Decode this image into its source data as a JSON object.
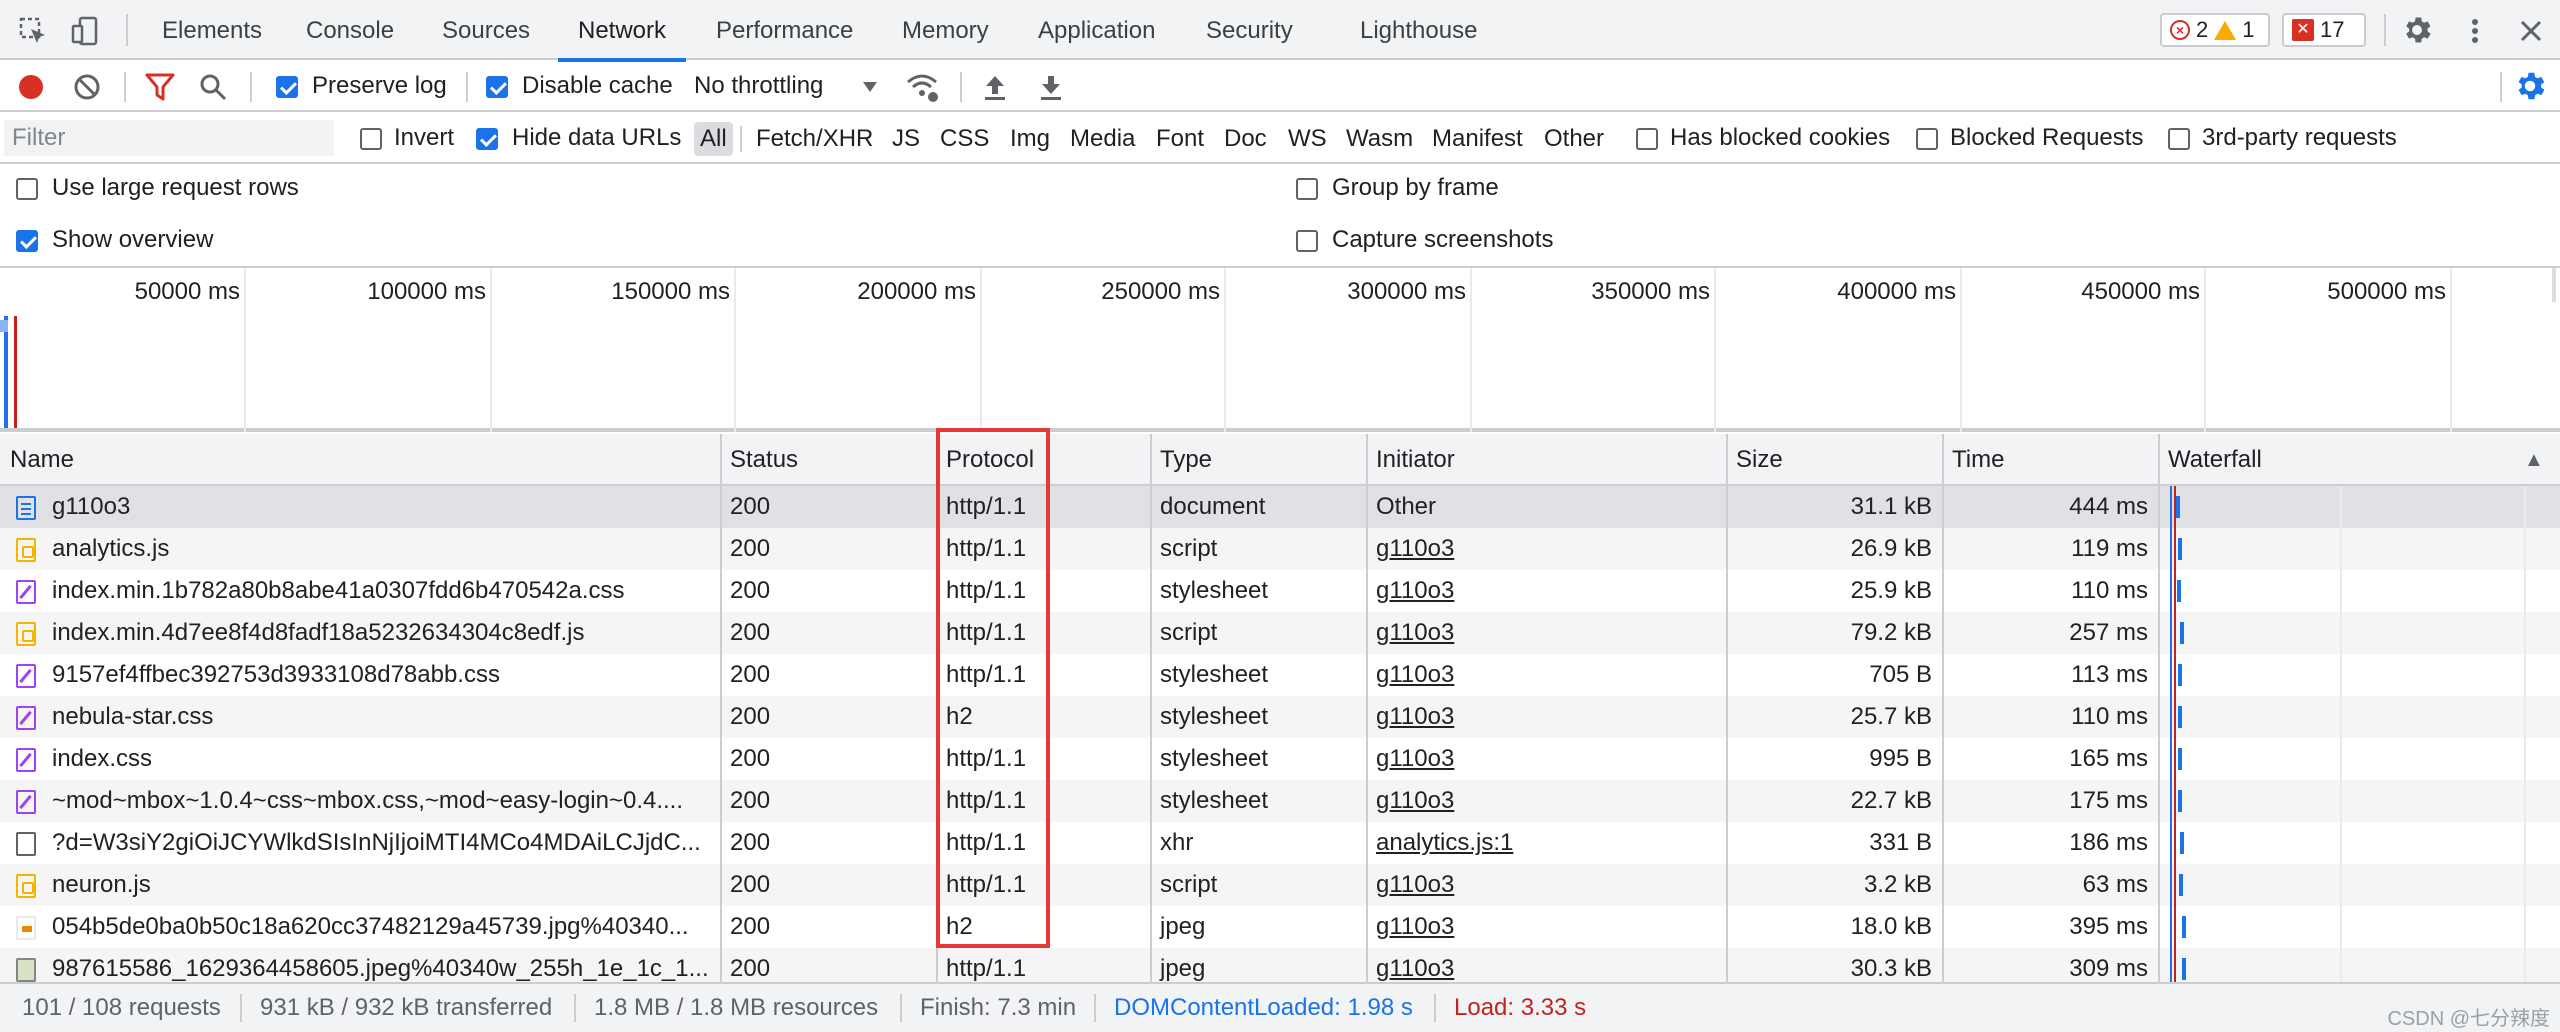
{
  "tabs": [
    "Elements",
    "Console",
    "Sources",
    "Network",
    "Performance",
    "Memory",
    "Application",
    "Security",
    "Lighthouse"
  ],
  "active_tab": "Network",
  "badges": {
    "errors": "2",
    "warnings": "1",
    "issues": "17"
  },
  "toolbar": {
    "preserve_log": "Preserve log",
    "disable_cache": "Disable cache",
    "throttling": "No throttling"
  },
  "filter": {
    "placeholder": "Filter",
    "invert": "Invert",
    "hide_data_urls": "Hide data URLs",
    "types": [
      "All",
      "Fetch/XHR",
      "JS",
      "CSS",
      "Img",
      "Media",
      "Font",
      "Doc",
      "WS",
      "Wasm",
      "Manifest",
      "Other"
    ],
    "has_blocked_cookies": "Has blocked cookies",
    "blocked_requests": "Blocked Requests",
    "third_party": "3rd-party requests"
  },
  "settings": {
    "large_rows": "Use large request rows",
    "group_by_frame": "Group by frame",
    "show_overview": "Show overview",
    "capture_screenshots": "Capture screenshots"
  },
  "overview_ticks": [
    "50000 ms",
    "100000 ms",
    "150000 ms",
    "200000 ms",
    "250000 ms",
    "300000 ms",
    "350000 ms",
    "400000 ms",
    "450000 ms",
    "500000 ms"
  ],
  "columns": [
    "Name",
    "Status",
    "Protocol",
    "Type",
    "Initiator",
    "Size",
    "Time",
    "Waterfall"
  ],
  "sort_indicator": "▲",
  "rows": [
    {
      "name": "g110o3",
      "status": "200",
      "protocol": "http/1.1",
      "type": "document",
      "initiator": "Other",
      "size": "31.1 kB",
      "time": "444 ms",
      "icon": "doc"
    },
    {
      "name": "analytics.js",
      "status": "200",
      "protocol": "http/1.1",
      "type": "script",
      "initiator": "g110o3",
      "size": "26.9 kB",
      "time": "119 ms",
      "icon": "script"
    },
    {
      "name": "index.min.1b782a80b8abe41a0307fdd6b470542a.css",
      "status": "200",
      "protocol": "http/1.1",
      "type": "stylesheet",
      "initiator": "g110o3",
      "size": "25.9 kB",
      "time": "110 ms",
      "icon": "css"
    },
    {
      "name": "index.min.4d7ee8f4d8fadf18a5232634304c8edf.js",
      "status": "200",
      "protocol": "http/1.1",
      "type": "script",
      "initiator": "g110o3",
      "size": "79.2 kB",
      "time": "257 ms",
      "icon": "script"
    },
    {
      "name": "9157ef4ffbec392753d3933108d78abb.css",
      "status": "200",
      "protocol": "http/1.1",
      "type": "stylesheet",
      "initiator": "g110o3",
      "size": "705 B",
      "time": "113 ms",
      "icon": "css"
    },
    {
      "name": "nebula-star.css",
      "status": "200",
      "protocol": "h2",
      "type": "stylesheet",
      "initiator": "g110o3",
      "size": "25.7 kB",
      "time": "110 ms",
      "icon": "css"
    },
    {
      "name": "index.css",
      "status": "200",
      "protocol": "http/1.1",
      "type": "stylesheet",
      "initiator": "g110o3",
      "size": "995 B",
      "time": "165 ms",
      "icon": "css"
    },
    {
      "name": "~mod~mbox~1.0.4~css~mbox.css,~mod~easy-login~0.4....",
      "status": "200",
      "protocol": "http/1.1",
      "type": "stylesheet",
      "initiator": "g110o3",
      "size": "22.7 kB",
      "time": "175 ms",
      "icon": "css"
    },
    {
      "name": "?d=W3siY2giOiJCYWlkdSIsInNjIjoiMTI4MCo4MDAiLCJjdC...",
      "status": "200",
      "protocol": "http/1.1",
      "type": "xhr",
      "initiator": "analytics.js:1",
      "size": "331 B",
      "time": "186 ms",
      "icon": "xhr"
    },
    {
      "name": "neuron.js",
      "status": "200",
      "protocol": "http/1.1",
      "type": "script",
      "initiator": "g110o3",
      "size": "3.2 kB",
      "time": "63 ms",
      "icon": "script"
    },
    {
      "name": "054b5de0ba0b50c18a620cc37482129a45739.jpg%40340...",
      "status": "200",
      "protocol": "h2",
      "type": "jpeg",
      "initiator": "g110o3",
      "size": "18.0 kB",
      "time": "395 ms",
      "icon": "img"
    },
    {
      "name": "987615586_1629364458605.jpeg%40340w_255h_1e_1c_1...",
      "status": "200",
      "protocol": "http/1.1",
      "type": "jpeg",
      "initiator": "g110o3",
      "size": "30.3 kB",
      "time": "309 ms",
      "icon": "img2"
    }
  ],
  "statusbar": {
    "requests": "101 / 108 requests",
    "transferred": "931 kB / 932 kB transferred",
    "resources": "1.8 MB / 1.8 MB resources",
    "finish": "Finish: 7.3 min",
    "dcl": "DOMContentLoaded: 1.98 s",
    "load": "Load: 3.33 s"
  },
  "watermark": "CSDN @七分辣度",
  "colors": {
    "accent": "#1a73e8",
    "record": "#d93025",
    "highlight": "#e53935",
    "dcl": "#1a73e8",
    "load": "#c5221f"
  }
}
